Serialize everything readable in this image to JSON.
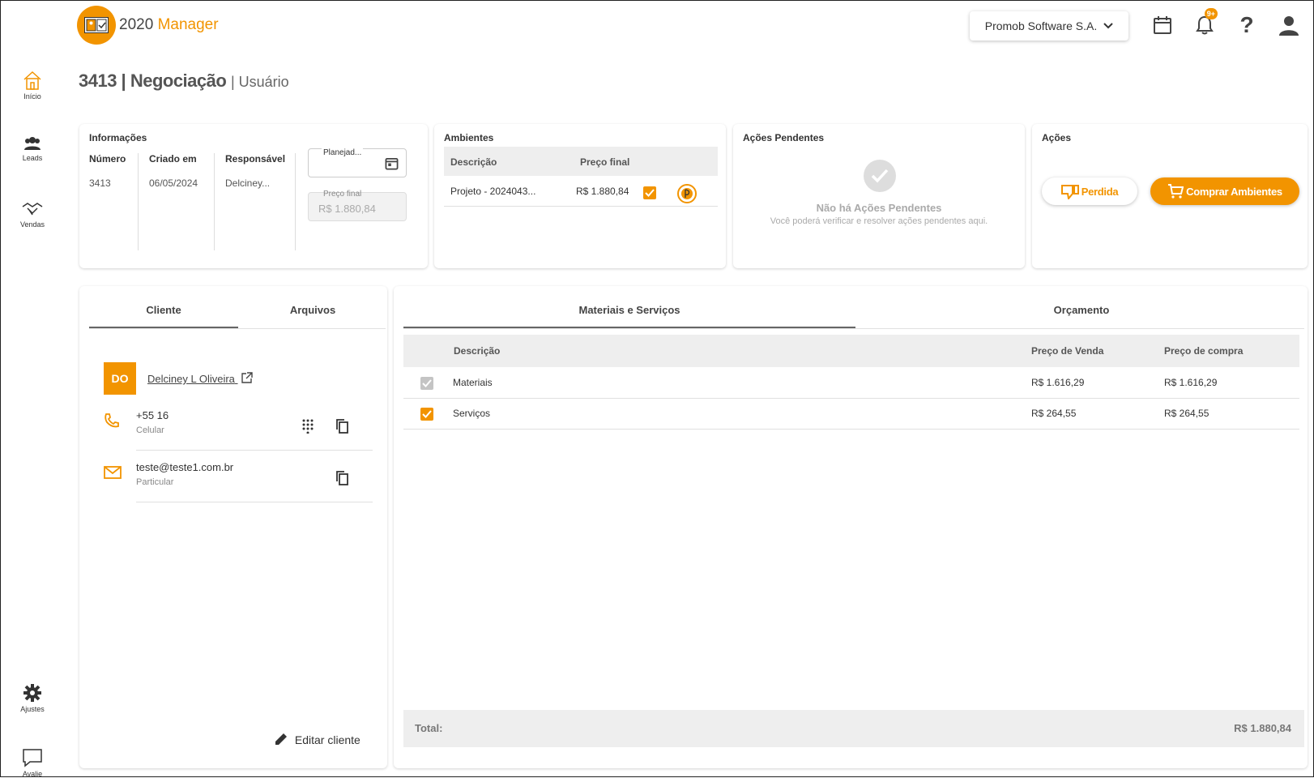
{
  "app": {
    "title_main": "2020",
    "title_accent": "Manager",
    "company": "Promob Software S.A.",
    "notifications_badge": "9+",
    "help_label": "?"
  },
  "sidebar": {
    "items": [
      {
        "label": "Início"
      },
      {
        "label": "Leads"
      },
      {
        "label": "Vendas"
      },
      {
        "label": "Ajustes"
      },
      {
        "label": "Avalie"
      }
    ]
  },
  "page": {
    "title": "3413 | Negociação",
    "subtitle": "| Usuário"
  },
  "informacoes": {
    "title": "Informações",
    "headers": [
      "Número",
      "Criado em",
      "Responsável"
    ],
    "values": [
      "3413",
      "06/05/2024",
      "Delciney..."
    ],
    "status_label": "Planejad...",
    "preco_label": "Preço final",
    "preco_value": "R$ 1.880,84"
  },
  "ambientes": {
    "title": "Ambientes",
    "headers": [
      "Descrição",
      "Preço final"
    ],
    "rows": [
      {
        "descricao": "Projeto - 2024043...",
        "preco": "R$ 1.880,84"
      }
    ]
  },
  "acoes_pendentes": {
    "title": "Ações Pendentes",
    "empty_title": "Não há Ações Pendentes",
    "empty_desc": "Você poderá verificar e resolver ações pendentes aqui."
  },
  "acoes": {
    "title": "Ações",
    "perdida": "Perdida",
    "comprar": "Comprar Ambientes"
  },
  "cliente_panel": {
    "tabs": [
      "Cliente",
      "Arquivos"
    ],
    "initials": "DO",
    "name": "Delciney L Oliveira",
    "phone": "+55 16",
    "phone_type": "Celular",
    "email": "teste@teste1.com.br",
    "email_type": "Particular",
    "edit": "Editar cliente"
  },
  "materiais_panel": {
    "tabs": [
      "Materiais e Serviços",
      "Orçamento"
    ],
    "headers": [
      "Descrição",
      "Preço de Venda",
      "Preço de compra"
    ],
    "rows": [
      {
        "descricao": "Materiais",
        "venda": "R$ 1.616,29",
        "compra": "R$ 1.616,29"
      },
      {
        "descricao": "Serviços",
        "venda": "R$ 264,55",
        "compra": "R$ 264,55"
      }
    ],
    "total_label": "Total:",
    "total_value": "R$ 1.880,84"
  },
  "colors": {
    "accent": "#f29400"
  }
}
